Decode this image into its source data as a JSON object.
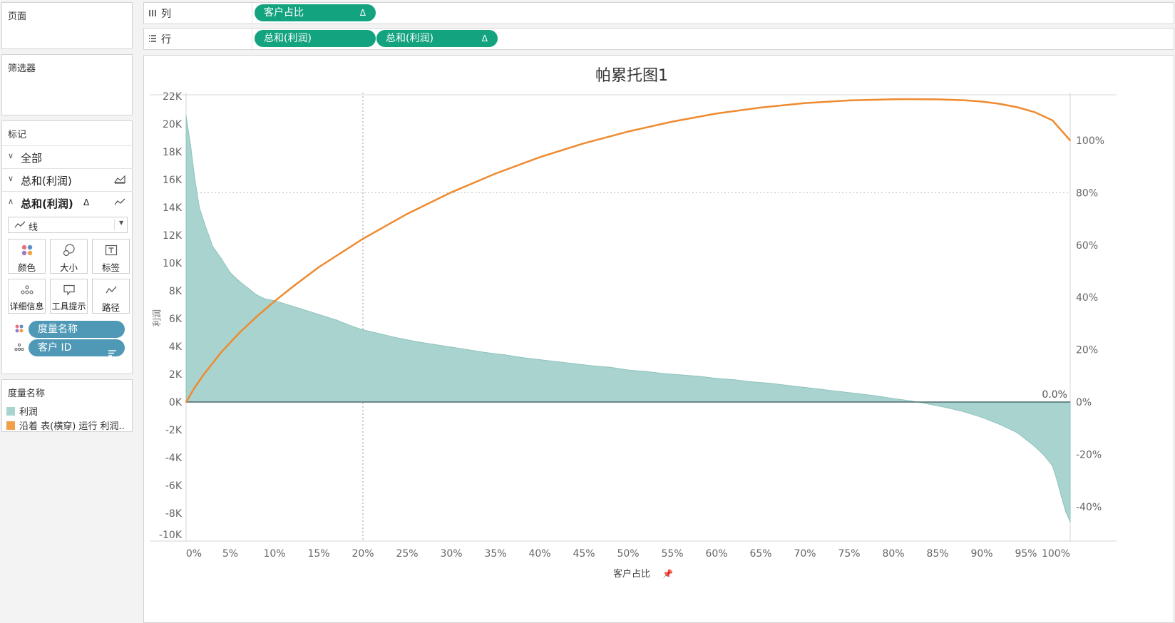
{
  "left_panel": {
    "pages_title": "页面",
    "filters_title": "筛选器",
    "marks_title": "标记",
    "marks_rows": [
      {
        "label": "全部"
      },
      {
        "label": "总和(利润)"
      },
      {
        "label": "总和(利润)",
        "delta": "Δ"
      }
    ],
    "mark_type": "线",
    "buttons": {
      "color": "颜色",
      "size": "大小",
      "label": "标签",
      "detail": "详细信息",
      "tooltip": "工具提示",
      "path": "路径"
    },
    "fields": [
      {
        "label": "度量名称"
      },
      {
        "label": "客户 ID"
      }
    ],
    "legend_title": "度量名称",
    "legend_items": [
      {
        "label": "利润",
        "color": "#a9d3cf"
      },
      {
        "label": "沿着 表(横穿) 运行 利润..",
        "color": "#f0a04b"
      }
    ]
  },
  "shelves": {
    "columns_label": "列",
    "rows_label": "行",
    "columns_pill": "客户占比",
    "rows_pills": [
      "总和(利润)",
      "总和(利润)"
    ],
    "delta": "Δ"
  },
  "chart_data": {
    "type": "area",
    "title": "帕累托图1",
    "xlabel": "客户占比",
    "ylabel": "利润",
    "y_ticks": [
      "22K",
      "20K",
      "18K",
      "16K",
      "14K",
      "12K",
      "10K",
      "8K",
      "6K",
      "4K",
      "2K",
      "0K",
      "-2K",
      "-4K",
      "-6K",
      "-8K",
      "-10K"
    ],
    "y2_ticks": [
      "100%",
      "80%",
      "60%",
      "40%",
      "20%",
      "0%",
      "-20%",
      "-40%"
    ],
    "x_ticks": [
      "0%",
      "5%",
      "10%",
      "15%",
      "20%",
      "25%",
      "30%",
      "35%",
      "40%",
      "45%",
      "50%",
      "55%",
      "60%",
      "65%",
      "70%",
      "75%",
      "80%",
      "85%",
      "90%",
      "95%",
      "100%"
    ],
    "xlim": [
      0,
      100
    ],
    "ylim": [
      -10000,
      22000
    ],
    "y2lim": [
      -0.5283,
      1.17
    ],
    "reference_lines": {
      "x": 20,
      "y2": 0.8
    },
    "end_label": "0.0%",
    "series": [
      {
        "name": "利润",
        "color": "#a9d3cf",
        "x": [
          0,
          0.5,
          1,
          1.5,
          2,
          3,
          4,
          5,
          6,
          7,
          8,
          9,
          10,
          11,
          12,
          13,
          14,
          15,
          16,
          17,
          18,
          19,
          20,
          22,
          24,
          26,
          28,
          30,
          32,
          34,
          36,
          38,
          40,
          42,
          44,
          46,
          48,
          50,
          52,
          54,
          56,
          58,
          60,
          62,
          64,
          66,
          68,
          70,
          72,
          74,
          76,
          78,
          80,
          82,
          84,
          86,
          88,
          90,
          92,
          94,
          95,
          96,
          97,
          98,
          98.5,
          99,
          99.5,
          100
        ],
        "values": [
          20600,
          18500,
          16000,
          14000,
          13000,
          11200,
          10300,
          9300,
          8700,
          8200,
          7700,
          7400,
          7300,
          7100,
          6900,
          6700,
          6500,
          6300,
          6100,
          5900,
          5650,
          5400,
          5200,
          4900,
          4600,
          4350,
          4150,
          3950,
          3750,
          3550,
          3400,
          3200,
          3050,
          2900,
          2750,
          2600,
          2500,
          2300,
          2200,
          2050,
          1950,
          1850,
          1700,
          1600,
          1450,
          1350,
          1200,
          1050,
          900,
          750,
          600,
          450,
          250,
          80,
          -150,
          -400,
          -700,
          -1100,
          -1600,
          -2200,
          -2700,
          -3200,
          -3800,
          -4600,
          -5600,
          -6800,
          -7900,
          -8600
        ]
      },
      {
        "name": "沿着 表(横穿) 运行 利润..",
        "color": "#ee8a2f",
        "x": [
          0,
          1,
          2,
          4,
          6,
          8,
          10,
          12,
          15,
          20,
          25,
          30,
          35,
          40,
          45,
          50,
          55,
          60,
          65,
          70,
          75,
          80,
          82,
          85,
          88,
          90,
          92,
          94,
          96,
          98,
          100
        ],
        "values": [
          0,
          0.0572,
          0.1056,
          0.1913,
          0.2636,
          0.3271,
          0.385,
          0.439,
          0.5153,
          0.6238,
          0.7191,
          0.8016,
          0.8733,
          0.9358,
          0.9889,
          1.0339,
          1.0718,
          1.1028,
          1.1257,
          1.1426,
          1.153,
          1.1572,
          1.1577,
          1.1569,
          1.1536,
          1.1485,
          1.14,
          1.127,
          1.108,
          1.0765,
          1.0
        ]
      }
    ]
  }
}
